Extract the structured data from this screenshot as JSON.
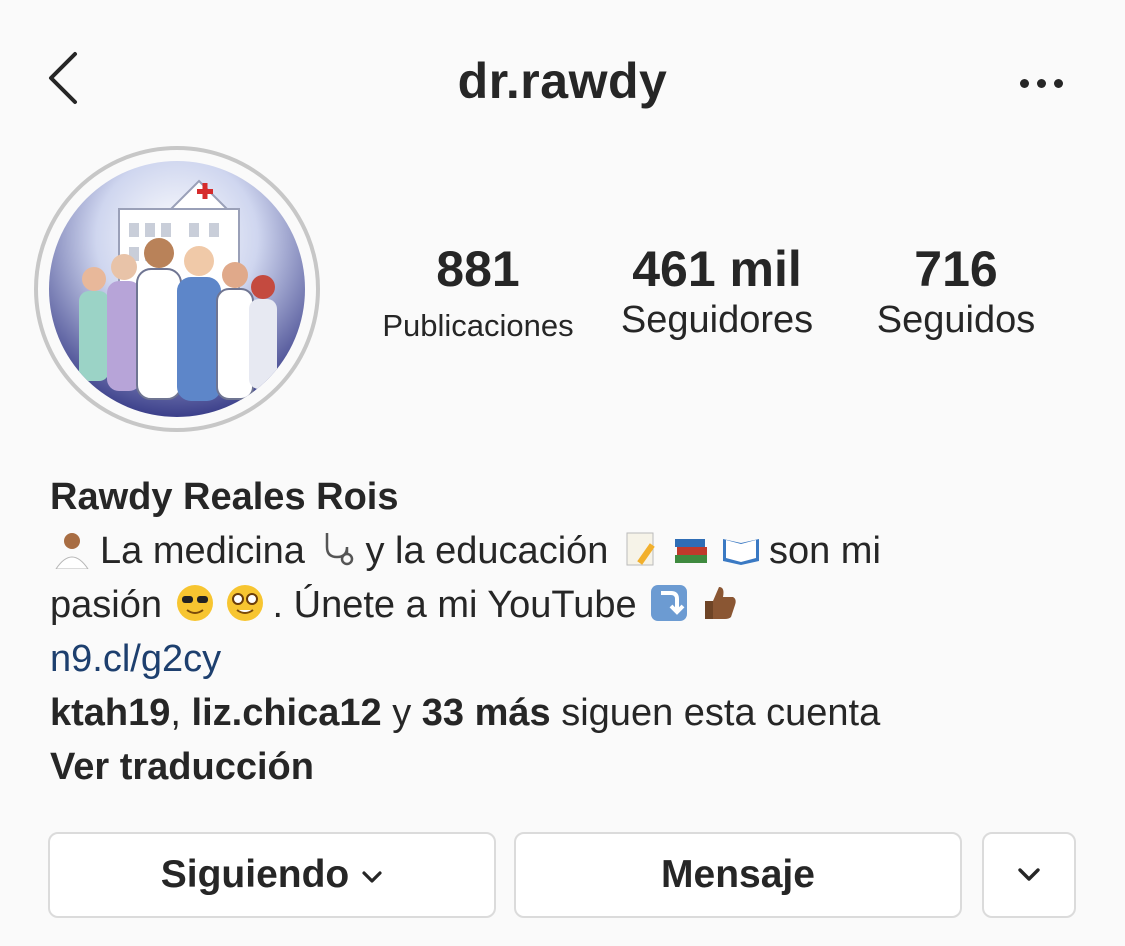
{
  "header": {
    "username": "dr.rawdy",
    "back_icon": "chevron-left-icon",
    "more_icon": "ellipsis-icon"
  },
  "stats": {
    "posts": {
      "value": "881",
      "label": "Publicaciones"
    },
    "followers": {
      "value": "461 mil",
      "label": "Seguidores"
    },
    "following": {
      "value": "716",
      "label": "Seguidos"
    }
  },
  "bio": {
    "display_name": "Rawdy Reales Rois",
    "line1_a": "La medicina",
    "line1_b": "y la educación",
    "line1_c": "son mi",
    "line2_a": "pasión",
    "line2_b": ". Únete a mi YouTube",
    "link": "n9.cl/g2cy",
    "followed_by": {
      "user1": "ktah19",
      "sep": ", ",
      "user2": "liz.chica12",
      "and": " y ",
      "more": "33 más",
      "suffix": " siguen esta cuenta"
    },
    "translate": "Ver traducción",
    "emojis": [
      "man-health-worker-emoji",
      "stethoscope-emoji",
      "memo-emoji",
      "books-emoji",
      "open-book-emoji",
      "sunglasses-face-emoji",
      "nerd-face-emoji",
      "down-arrow-emoji",
      "thumbs-up-emoji"
    ]
  },
  "actions": {
    "following_label": "Siguiendo",
    "message_label": "Mensaje",
    "dropdown_icon": "chevron-down-icon"
  },
  "colors": {
    "background": "#fafafa",
    "text": "#262626",
    "link": "#1d3f6e",
    "border": "#dbdbdb",
    "avatar_ring": "#c7c7c7"
  }
}
